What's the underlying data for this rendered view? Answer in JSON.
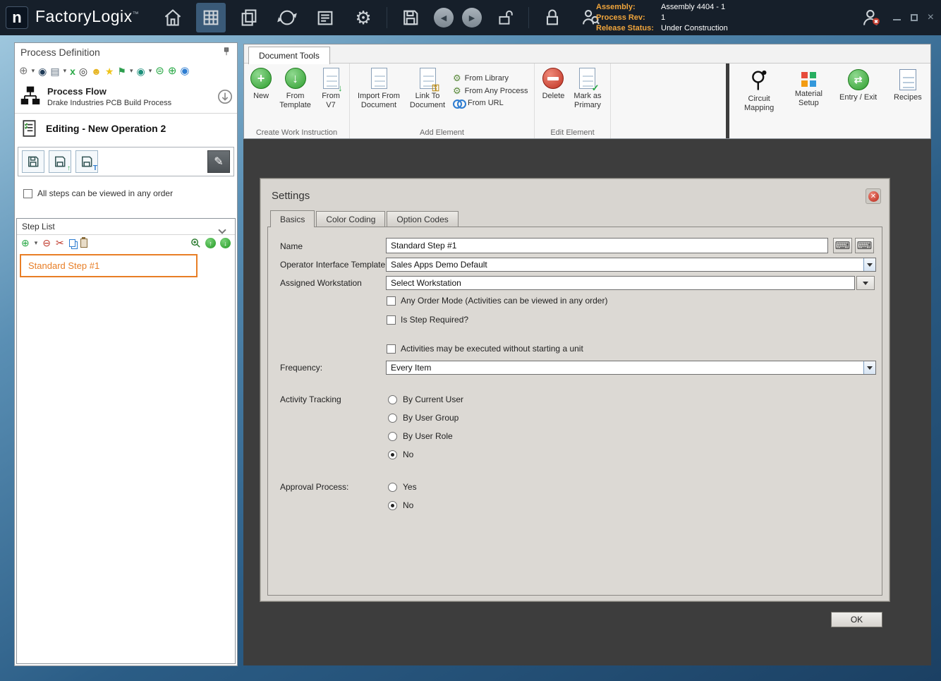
{
  "window": {
    "app_name": "FactoryLogix",
    "trademark": "™",
    "assembly_label": "Assembly:",
    "assembly_value": "Assembly 4404 - 1",
    "process_rev_label": "Process Rev:",
    "process_rev_value": "1",
    "release_status_label": "Release Status:",
    "release_status_value": "Under Construction"
  },
  "left_panel": {
    "title": "Process Definition",
    "process_flow_title": "Process Flow",
    "process_flow_subtitle": "Drake Industries PCB Build Process",
    "editing_label": "Editing - New Operation 2",
    "any_order_checkbox_label": "All steps can be viewed in any order",
    "any_order_checked": false,
    "step_list_header": "Step List",
    "steps": [
      {
        "name": "Standard Step #1"
      }
    ],
    "selected_step": "Standard Step #1"
  },
  "ribbon": {
    "tab_label": "Document Tools",
    "create_group": {
      "name": "Create Work Instruction",
      "new_label": "New",
      "from_template_label": "From Template",
      "from_v7_label": "From V7"
    },
    "add_group": {
      "name": "Add Element",
      "import_label": "Import From Document",
      "link_label": "Link To Document",
      "from_library_label": "From Library",
      "from_any_process_label": "From Any Process",
      "from_url_label": "From URL"
    },
    "edit_group": {
      "name": "Edit Element",
      "delete_label": "Delete",
      "mark_primary_label": "Mark as Primary"
    },
    "tools": {
      "circuit_mapping_label": "Circuit Mapping",
      "material_setup_label": "Material Setup",
      "entry_exit_label": "Entry / Exit",
      "recipes_label": "Recipes"
    }
  },
  "settings": {
    "title": "Settings",
    "tabs": [
      "Basics",
      "Color Coding",
      "Option Codes"
    ],
    "active_tab": "Basics",
    "name_label": "Name",
    "name_value": "Standard Step #1",
    "template_label": "Operator Interface Template",
    "template_value": "Sales Apps Demo Default",
    "workstation_label": "Assigned Workstation",
    "workstation_value": "Select Workstation",
    "any_order_label": "Any Order Mode (Activities can be viewed in any order)",
    "any_order_checked": false,
    "required_label": "Is Step Required?",
    "required_checked": false,
    "activities_label": "Activities may be executed without starting a unit",
    "activities_checked": false,
    "frequency_label": "Frequency:",
    "frequency_value": "Every Item",
    "activity_tracking_label": "Activity Tracking",
    "activity_options": [
      "By Current User",
      "By User Group",
      "By User Role",
      "No"
    ],
    "activity_selected": "No",
    "approval_label": "Approval Process:",
    "approval_options": [
      "Yes",
      "No"
    ],
    "approval_selected": "No",
    "ok_label": "OK"
  }
}
